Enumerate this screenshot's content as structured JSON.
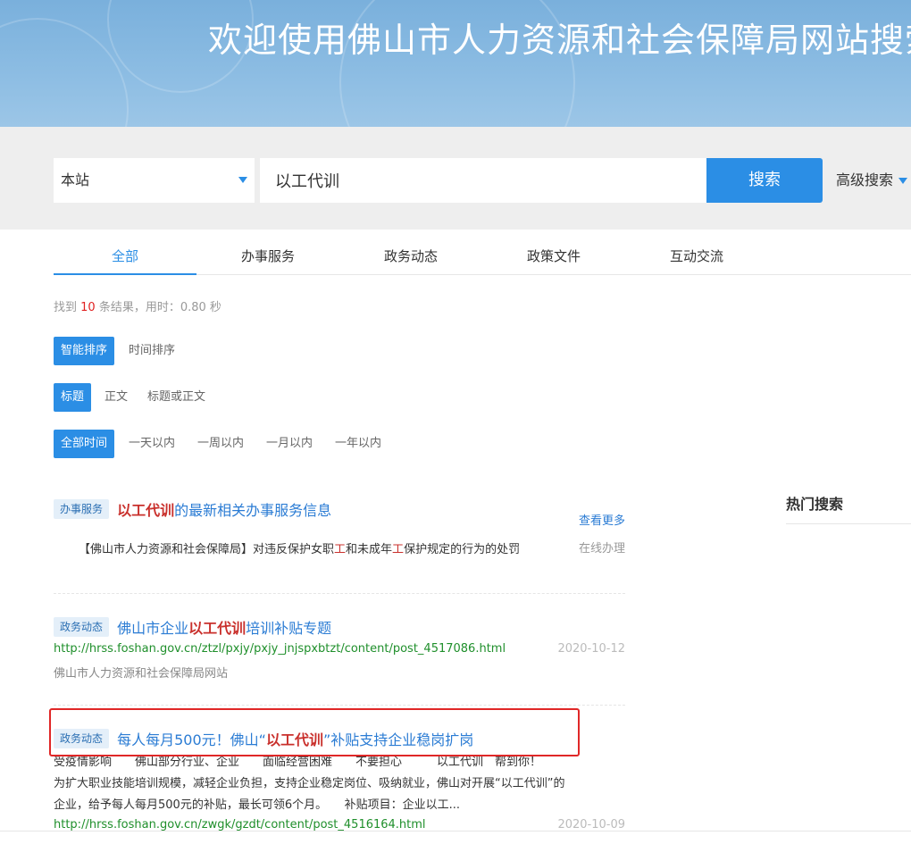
{
  "banner": {
    "title": "欢迎使用佛山市人力资源和社会保障局网站搜索平台"
  },
  "search": {
    "scope": "本站",
    "query": "以工代训",
    "button": "搜索",
    "advanced": "高级搜索"
  },
  "tabs": [
    "全部",
    "办事服务",
    "政务动态",
    "政策文件",
    "互动交流"
  ],
  "result_count": {
    "prefix": "找到",
    "count": "10",
    "suffix": "条结果，用时：0.80 秒"
  },
  "filters": {
    "sort": [
      "智能排序",
      "时间排序"
    ],
    "field": [
      "标题",
      "正文",
      "标题或正文"
    ],
    "time": [
      "全部时间",
      "一天以内",
      "一周以内",
      "一月以内",
      "一年以内"
    ]
  },
  "results": [
    {
      "tag": "办事服务",
      "title_kw": "以工代训",
      "title_rest": "的最新相关办事服务信息",
      "more": "查看更多",
      "online": "在线办理",
      "desc_a": "【佛山市人力资源和社会保障局】对违反保护女职",
      "desc_b": "工",
      "desc_c": "和未成年",
      "desc_d": "工",
      "desc_e": "保护规定的行为的处罚"
    },
    {
      "tag": "政务动态",
      "title_pre": "佛山市企业",
      "title_kw": "以工代训",
      "title_post": "培训补贴专题",
      "url": "http://hrss.foshan.gov.cn/ztzl/pxjy/pxjy_jnjspxbtzt/content/post_4517086.html",
      "date": "2020-10-12",
      "source": "佛山市人力资源和社会保障局网站"
    },
    {
      "tag": "政务动态",
      "title_pre": "每人每月500元！佛山“",
      "title_kw": "以工代训",
      "title_post": "”补贴支持企业稳岗扩岗",
      "snippet_1": "受疫情影响　　佛山部分行业、企业　　面临经营困难　　不要担心　　　以工代训　帮到你！",
      "snippet_2": "为扩大职业技能培训规模，减轻企业负担，支持企业稳定岗位、吸纳就业，佛山对开展“以工代训”的",
      "snippet_3": "企业，给予每人每月500元的补贴，最长可领6个月。　　补贴项目：企业以工...",
      "url": "http://hrss.foshan.gov.cn/zwgk/gzdt/content/post_4516164.html",
      "date": "2020-10-09"
    }
  ],
  "hot_search": {
    "title": "热门搜索"
  },
  "colors": {
    "accent": "#2b8ee5",
    "keyword": "#c9302c",
    "url": "#1f8f2b",
    "highlight_box": "#e02727"
  }
}
